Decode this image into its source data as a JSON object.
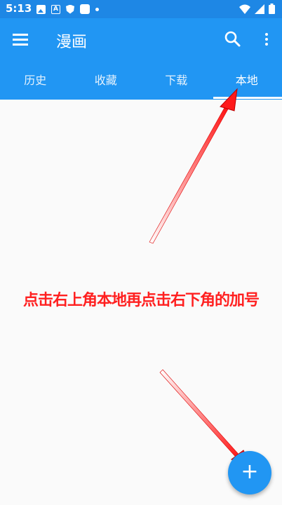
{
  "status_bar": {
    "time": "5:13",
    "left_icons": [
      "photo-icon",
      "text-a-icon",
      "shield-icon",
      "square-icon",
      "dot-icon"
    ],
    "right_icons": [
      "wifi-icon",
      "signal-icon",
      "battery-icon"
    ]
  },
  "app_bar": {
    "title": "漫画",
    "background": "#2196f3",
    "actions": [
      "menu-icon",
      "search-icon",
      "more-vert-icon"
    ]
  },
  "tabs": [
    {
      "label": "历史",
      "active": false
    },
    {
      "label": "收藏",
      "active": false
    },
    {
      "label": "下载",
      "active": false
    },
    {
      "label": "本地",
      "active": true
    }
  ],
  "annotation": {
    "text": "点击右上角本地再点击右下角的加号",
    "color": "#ff2020"
  },
  "fab": {
    "label": "+",
    "color": "#2196f3"
  }
}
